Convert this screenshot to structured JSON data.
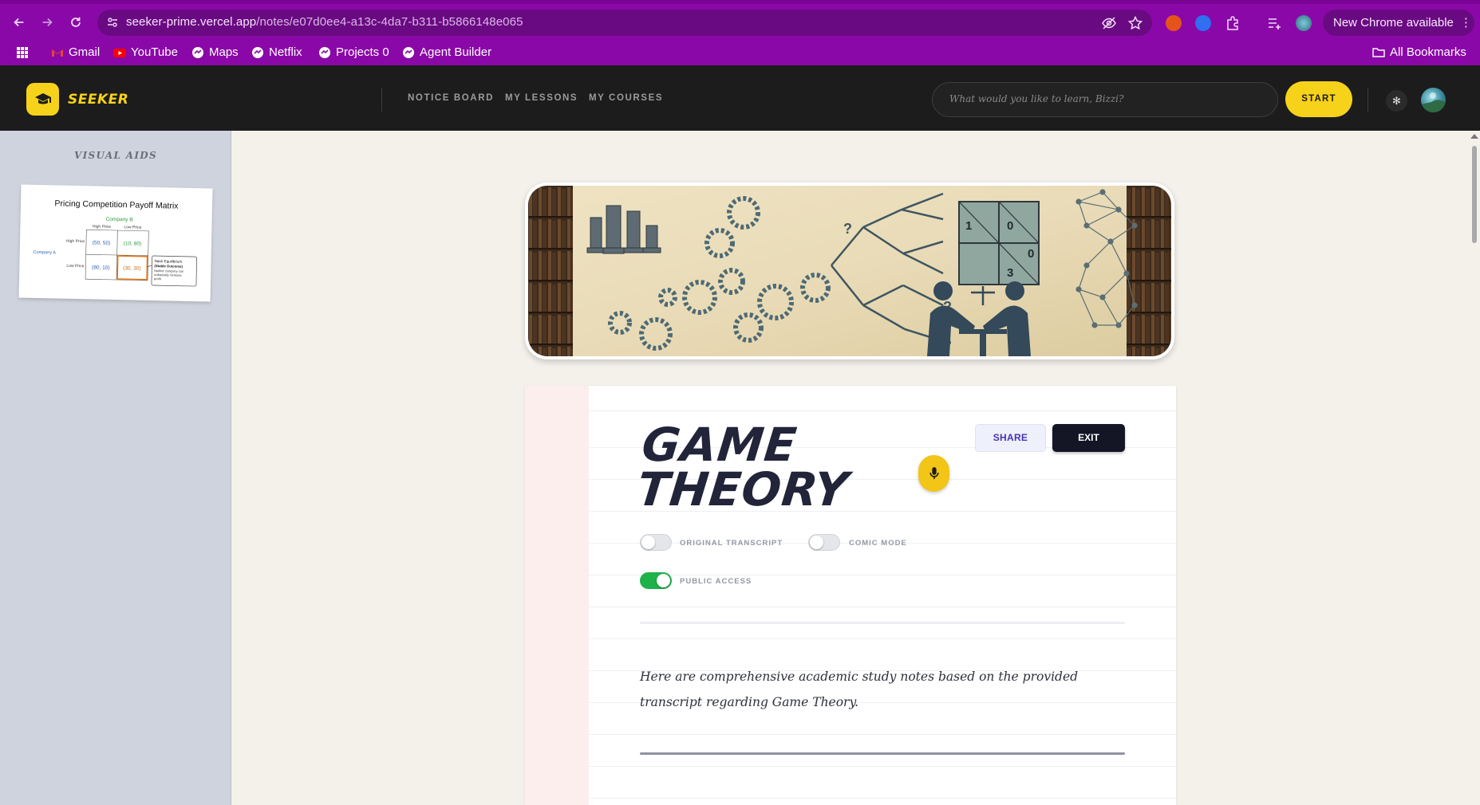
{
  "browser": {
    "url_host": "seeker-prime.vercel.app",
    "url_path": "/notes/e07d0ee4-a13c-4da7-b311-b5866148e065",
    "update_label": "New Chrome available",
    "bookmarks": [
      "Gmail",
      "YouTube",
      "Maps",
      "Netflix",
      "Projects 0",
      "Agent Builder"
    ],
    "all_bookmarks": "All Bookmarks",
    "accent": "#8a08a8"
  },
  "app": {
    "logo": "SEEKER",
    "nav": [
      "NOTICE BOARD",
      "MY LESSONS",
      "MY COURSES"
    ],
    "search_placeholder": "What would you like to learn, Bizzi?",
    "start_label": "START",
    "brand_color": "#f7d21a"
  },
  "sidebar": {
    "title": "VISUAL AIDS",
    "aid": {
      "title": "Pricing Competition Payoff Matrix",
      "company_b": "Company B",
      "company_a": "Company A",
      "col_headers": [
        "High Price",
        "Low Price"
      ],
      "row_headers": [
        "High Price",
        "Low Price"
      ],
      "cells": [
        "(50, 50)",
        "(10, 80)",
        "(80, 10)",
        "(30, 30)"
      ],
      "note_title": "Nash Equilibrium",
      "note_sub": "(Stable Outcome)",
      "note_body": [
        "Neither company can",
        "unilaterally increase",
        "profit."
      ]
    }
  },
  "note": {
    "title_line1": "GAME",
    "title_line2": "THEORY",
    "share_label": "SHARE",
    "exit_label": "EXIT",
    "toggles": [
      {
        "label": "ORIGINAL TRANSCRIPT",
        "on": false
      },
      {
        "label": "COMIC MODE",
        "on": false
      },
      {
        "label": "PUBLIC ACCESS",
        "on": true
      }
    ],
    "intro": "Here are comprehensive academic study notes based on the provided transcript regarding Game Theory.",
    "banner_matrix_values": [
      "1",
      "0",
      "3",
      "0"
    ]
  }
}
